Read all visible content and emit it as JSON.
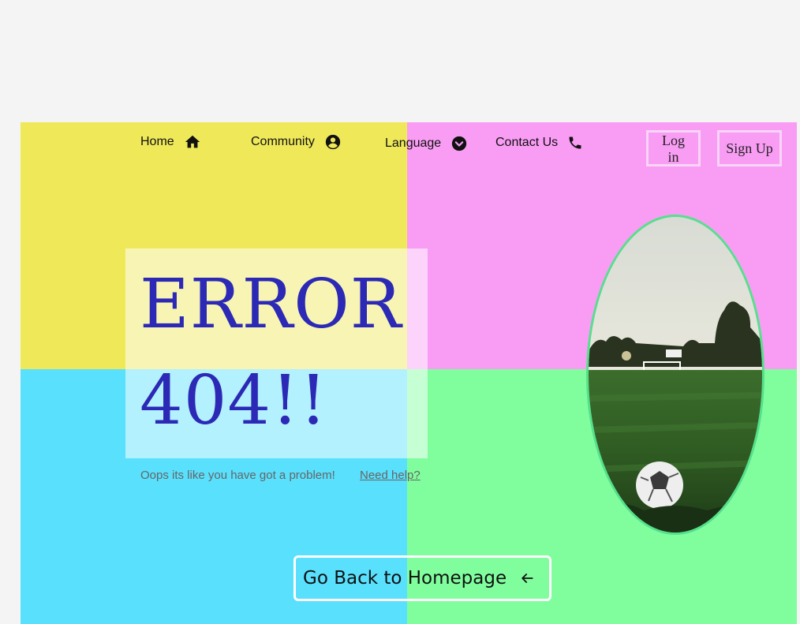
{
  "nav": {
    "home": {
      "label": "Home",
      "icon": "home-icon"
    },
    "community": {
      "label": "Community",
      "icon": "account-circle-icon"
    },
    "language": {
      "label": "Language",
      "icon": "chevron-down-circle-icon"
    },
    "contact": {
      "label": "Contact Us",
      "icon": "phone-icon"
    }
  },
  "auth": {
    "login_label": "Log in",
    "signup_label": "Sign Up"
  },
  "hero": {
    "title_line1": "ERROR",
    "title_line2": "404!!",
    "subtitle": "Oops its like you have got a problem!",
    "help_link": "Need help?"
  },
  "cta": {
    "label": "Go Back to Homepage",
    "icon": "arrow-left-icon"
  },
  "colors": {
    "yellow": "#efe95a",
    "pink": "#f99df4",
    "cyan": "#58e0fd",
    "green": "#80fe9e",
    "title": "#2b29b5"
  },
  "image": {
    "subject": "soccer-field-photo"
  }
}
